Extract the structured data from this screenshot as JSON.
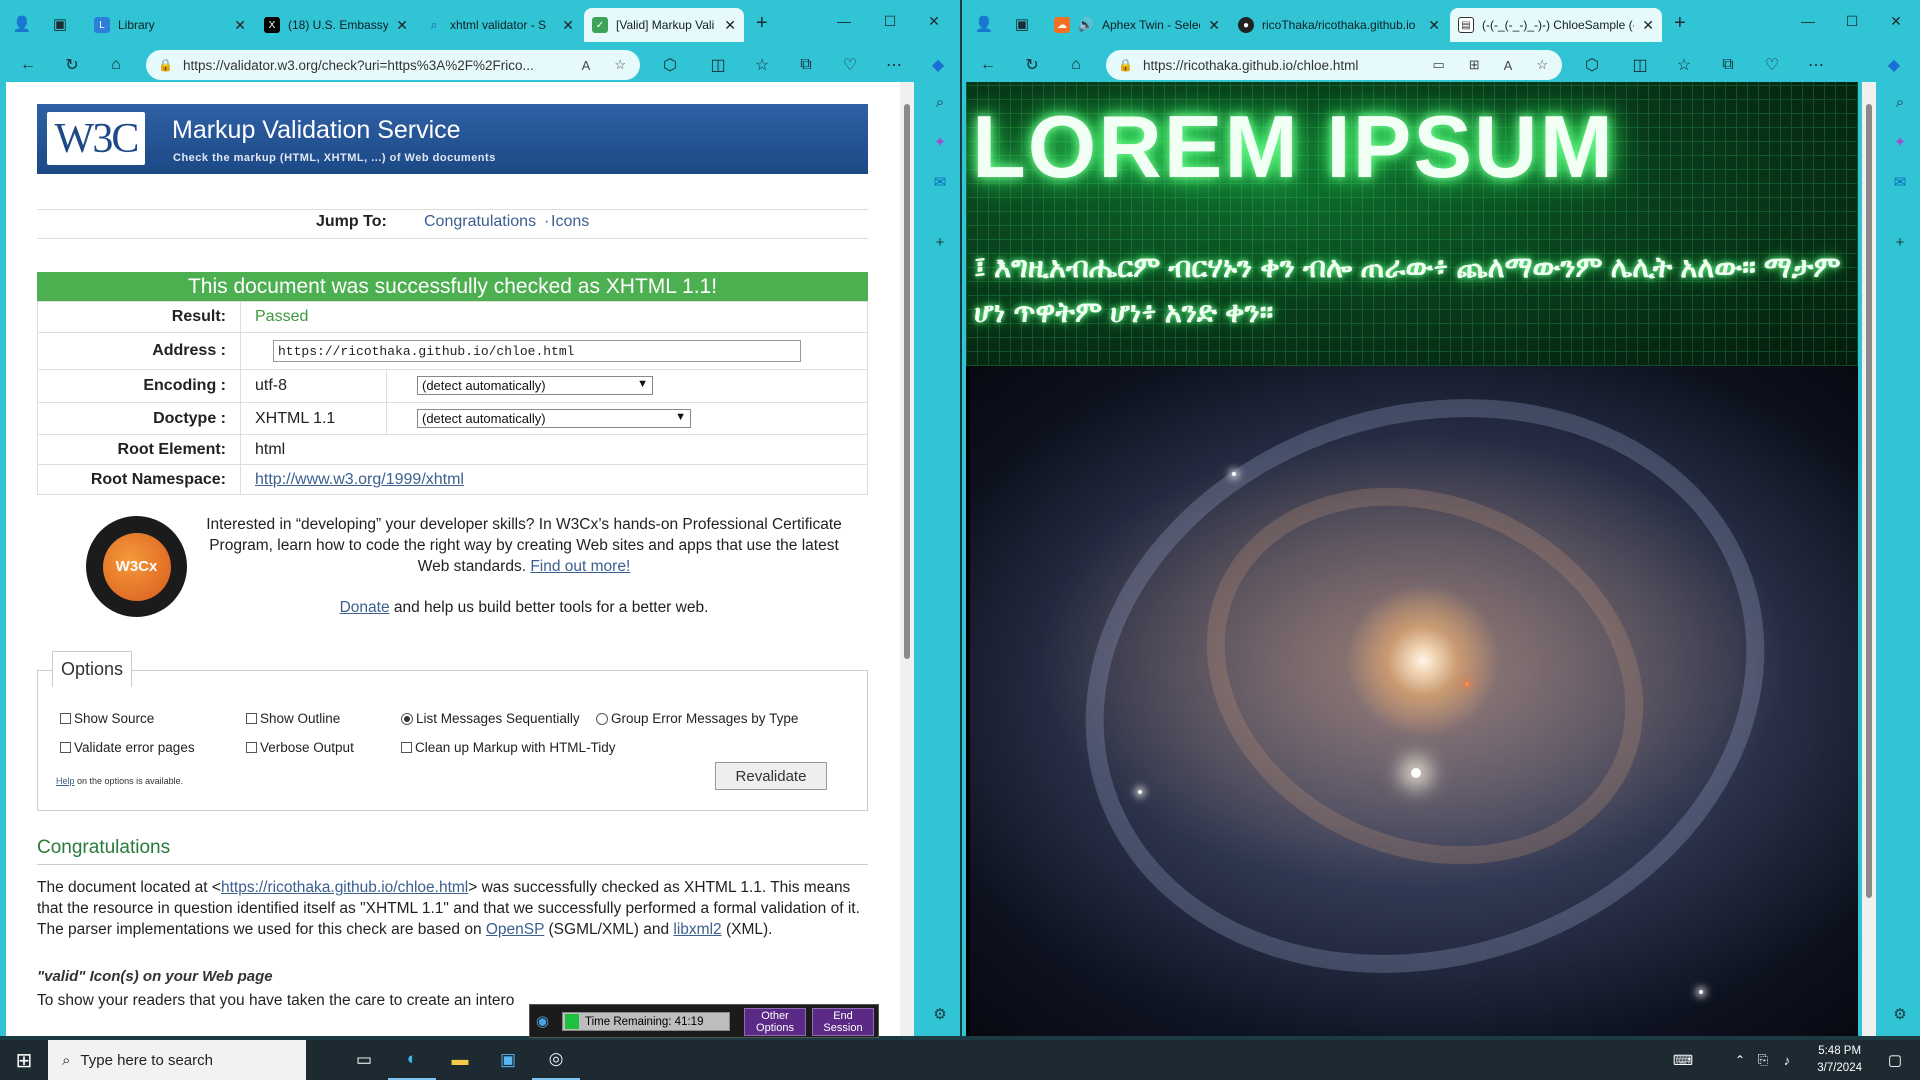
{
  "left_window": {
    "tabs": [
      {
        "label": "Library",
        "icon": "library-icon"
      },
      {
        "label": "(18) U.S. Embassy",
        "icon": "x-logo-icon"
      },
      {
        "label": "xhtml validator - S",
        "icon": "search-icon"
      },
      {
        "label": "[Valid] Markup Vali",
        "icon": "document-check-icon",
        "active": true
      }
    ],
    "url": "https://validator.w3.org/check?uri=https%3A%2F%2Frico..."
  },
  "validator": {
    "logo": "W3C",
    "title": "Markup Validation Service",
    "subtitle": "Check the markup (HTML, XHTML, ...) of Web documents",
    "jump_to": "Jump To:",
    "jump_links": [
      "Congratulations",
      "Icons"
    ],
    "jump_sep": "·",
    "success": "This document was successfully checked as XHTML 1.1!",
    "rows": {
      "result": {
        "label": "Result:",
        "value": "Passed"
      },
      "address": {
        "label": "Address :",
        "value": "https://ricothaka.github.io/chloe.html"
      },
      "encoding": {
        "label": "Encoding :",
        "value": "utf-8",
        "select": "(detect automatically)"
      },
      "doctype": {
        "label": "Doctype :",
        "value": "XHTML 1.1",
        "select": "(detect automatically)"
      },
      "root_element": {
        "label": "Root Element:",
        "value": "html"
      },
      "root_namespace": {
        "label": "Root Namespace:",
        "value": "http://www.w3.org/1999/xhtml"
      }
    },
    "promo_text": "Interested in “developing” your developer skills? In W3Cx’s hands-on Professional Certificate Program, learn how to code the right way by creating Web sites and apps that use the latest Web standards.",
    "promo_link": "Find out more!",
    "donate_link": "Donate",
    "donate_text": "and help us build better tools for a better web.",
    "badge_text": "W3Cx",
    "options": {
      "legend": "Options",
      "show_source": "Show Source",
      "show_outline": "Show Outline",
      "list_sequential": "List Messages Sequentially",
      "group_errors": "Group Error Messages by Type",
      "validate_error_pages": "Validate error pages",
      "verbose_output": "Verbose Output",
      "cleanup": "Clean up Markup with HTML-Tidy",
      "help_link": "Help",
      "help_text": "on the options is available.",
      "revalidate": "Revalidate"
    },
    "congrats_heading": "Congratulations",
    "congrats": {
      "t1": "The document located at <",
      "link1": "https://ricothaka.github.io/chloe.html",
      "t2": "> was successfully checked as XHTML 1.1. This means that the resource in question identified itself as \"XHTML 1.1\" and that we successfully performed a formal validation of it. The parser implementations we used for this check are based on ",
      "link2": "OpenSP",
      "t3": " (SGML/XML) and ",
      "link3": "libxml2",
      "t4": " (XML)."
    },
    "icons_heading": "\"valid\" Icon(s) on your Web page",
    "icons_text": "To show your readers that you have taken the care to create an intero"
  },
  "right_window": {
    "tabs": [
      {
        "label": "Aphex Twin - Selected A",
        "icon": "soundcloud-icon"
      },
      {
        "label": "ricoThaka/ricothaka.github.io",
        "icon": "github-icon"
      },
      {
        "label": "(-(-_(-_-)_-)-) ChloeSample (-",
        "icon": "document-icon",
        "active": true
      }
    ],
    "url": "https://ricothaka.github.io/chloe.html"
  },
  "chloe": {
    "title": "LOREM IPSUM",
    "amharic": "፤ እግዚአብሔርም ብርሃኑን ቀን ብሎ ጠራው፥ ጨለማውንም ሌሊት አለው። ማታም ሆነ ጥዋትም ሆነ፥ አንድ ቀን።"
  },
  "timer": {
    "text": "Time Remaining: 41:19",
    "other_options": "Other Options",
    "end_session": "End Session"
  },
  "taskbar": {
    "search_placeholder": "Type here to search",
    "time": "5:48 PM",
    "date": "3/7/2024"
  }
}
